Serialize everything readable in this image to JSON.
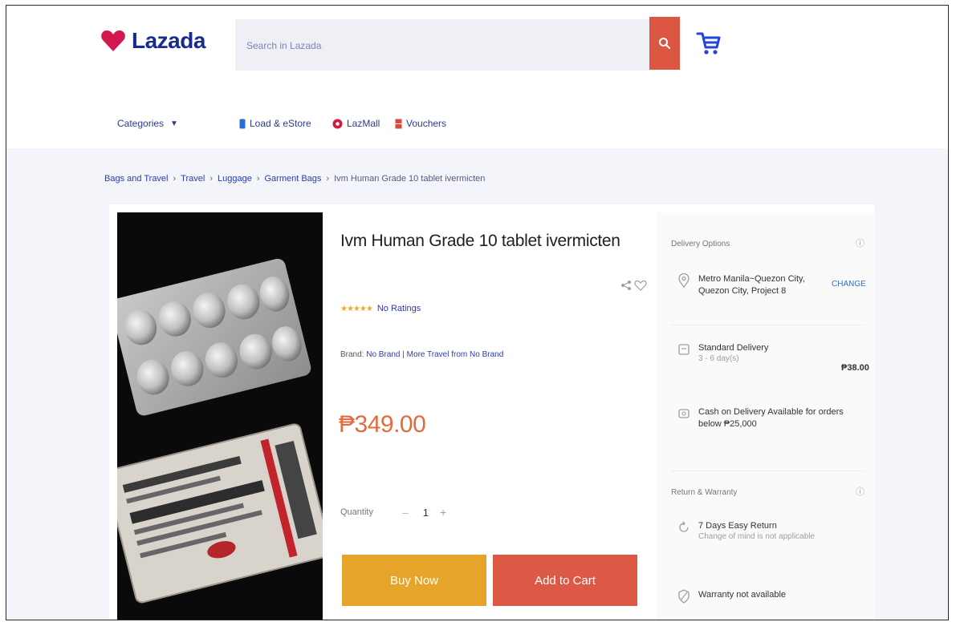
{
  "header": {
    "logo_text": "Lazada",
    "search_placeholder": "Search in Lazada",
    "search_button": "search-icon",
    "cart": "cart-icon"
  },
  "nav": {
    "categories_label": "Categories",
    "links": [
      {
        "label": "Load & eStore",
        "icon": "phone-icon",
        "color": "#2b6fd6"
      },
      {
        "label": "LazMall",
        "icon": "lazmall-icon",
        "color": "#d3173d"
      },
      {
        "label": "Vouchers",
        "icon": "voucher-icon",
        "color": "#e2453a"
      }
    ]
  },
  "breadcrumb": {
    "items": [
      "Bags and Travel",
      "Travel",
      "Luggage",
      "Garment Bags"
    ],
    "current": "Ivm Human Grade 10 tablet ivermicten"
  },
  "product": {
    "title": "Ivm Human Grade 10 tablet ivermicten",
    "rating_text": "No Ratings",
    "brand_label": "Brand:",
    "brand_value": "No Brand",
    "brand_more": "More Travel from No Brand",
    "price": "₱349.00",
    "quantity_label": "Quantity",
    "quantity_value": "1",
    "buy_now": "Buy Now",
    "add_to_cart": "Add to Cart"
  },
  "delivery": {
    "heading": "Delivery Options",
    "location": "Metro Manila~Quezon City, Quezon City, Project 8",
    "change": "CHANGE",
    "standard_title": "Standard Delivery",
    "standard_days": "3 - 6 day(s)",
    "standard_fee": "₱38.00",
    "cod": "Cash on Delivery Available for orders below ₱25,000"
  },
  "service": {
    "heading": "Return & Warranty",
    "returns_title": "7 Days Easy Return",
    "returns_sub": "Change of mind is not applicable",
    "warranty": "Warranty not available"
  },
  "colors": {
    "accent_orange": "#e6a52a",
    "accent_red": "#dc5a45",
    "brand_blue": "#1a2b8f",
    "price": "#e36a3f"
  }
}
